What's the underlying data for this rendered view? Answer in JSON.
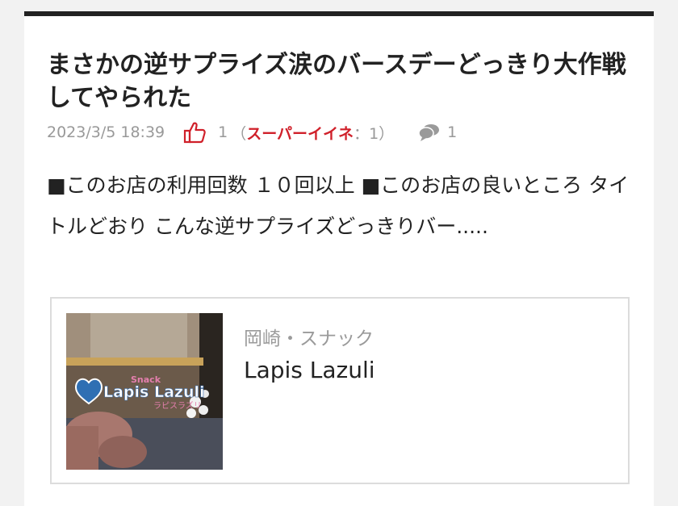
{
  "article": {
    "title": "まさかの逆サプライズ涙のバースデーどっきり大作戦してやられた",
    "date": "2023/3/5 18:39",
    "likes": "1",
    "super_open": "（",
    "super_label": "スーパーイイネ",
    "super_count": "：1）",
    "comments": "1",
    "excerpt": "■このお店の利用回数 １０回以上 ■このお店の良いところ タイトルどおり こんな逆サプライズどっきりバー....."
  },
  "shop": {
    "category": "岡崎・スナック",
    "name": "Lapis Lazuli",
    "logo_small": "Snack",
    "logo_main": "Lapis Lazuli",
    "logo_kana": "ラピスラズリ"
  },
  "icons": {
    "like": "thumbs-up-icon",
    "comment": "comment-bubbles-icon"
  },
  "colors": {
    "accent_red": "#d0202a",
    "top_border": "#222222"
  }
}
